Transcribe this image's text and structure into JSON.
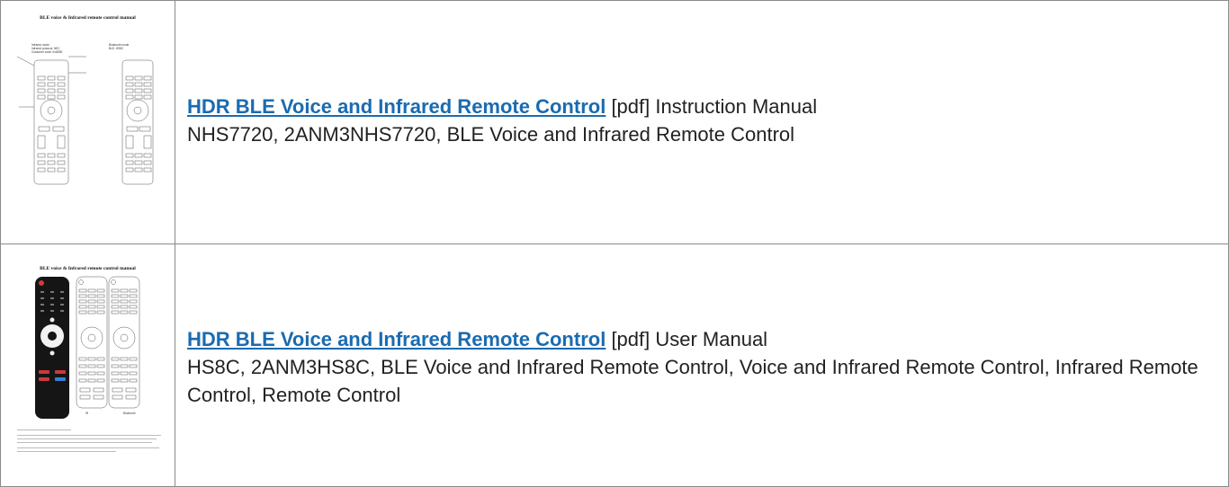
{
  "rows": [
    {
      "thumbnail": {
        "title": "BLE voice & Infrared remote control  manual",
        "left_heading": "Infrared mode",
        "left_sub1": "Infrared protocol: NEC",
        "left_sub2": "Customer code: 0x4B3E",
        "right_heading": "Bluetooth mode",
        "right_sub": "BLE: HS8C"
      },
      "link_text": "HDR BLE Voice and Infrared Remote Control",
      "manual_type": "[pdf] Instruction Manual",
      "models": "NHS7720, 2ANM3NHS7720, BLE Voice and Infrared Remote Control"
    },
    {
      "thumbnail": {
        "title": "BLE voice & Infrared remote control  manual",
        "caption_left": "IR",
        "caption_right": "Bluetooth"
      },
      "link_text": "HDR BLE Voice and Infrared Remote Control",
      "manual_type": "[pdf] User Manual",
      "models": "HS8C, 2ANM3HS8C, BLE Voice and Infrared Remote Control, Voice and Infrared Remote Control, Infrared Remote Control, Remote Control"
    }
  ]
}
